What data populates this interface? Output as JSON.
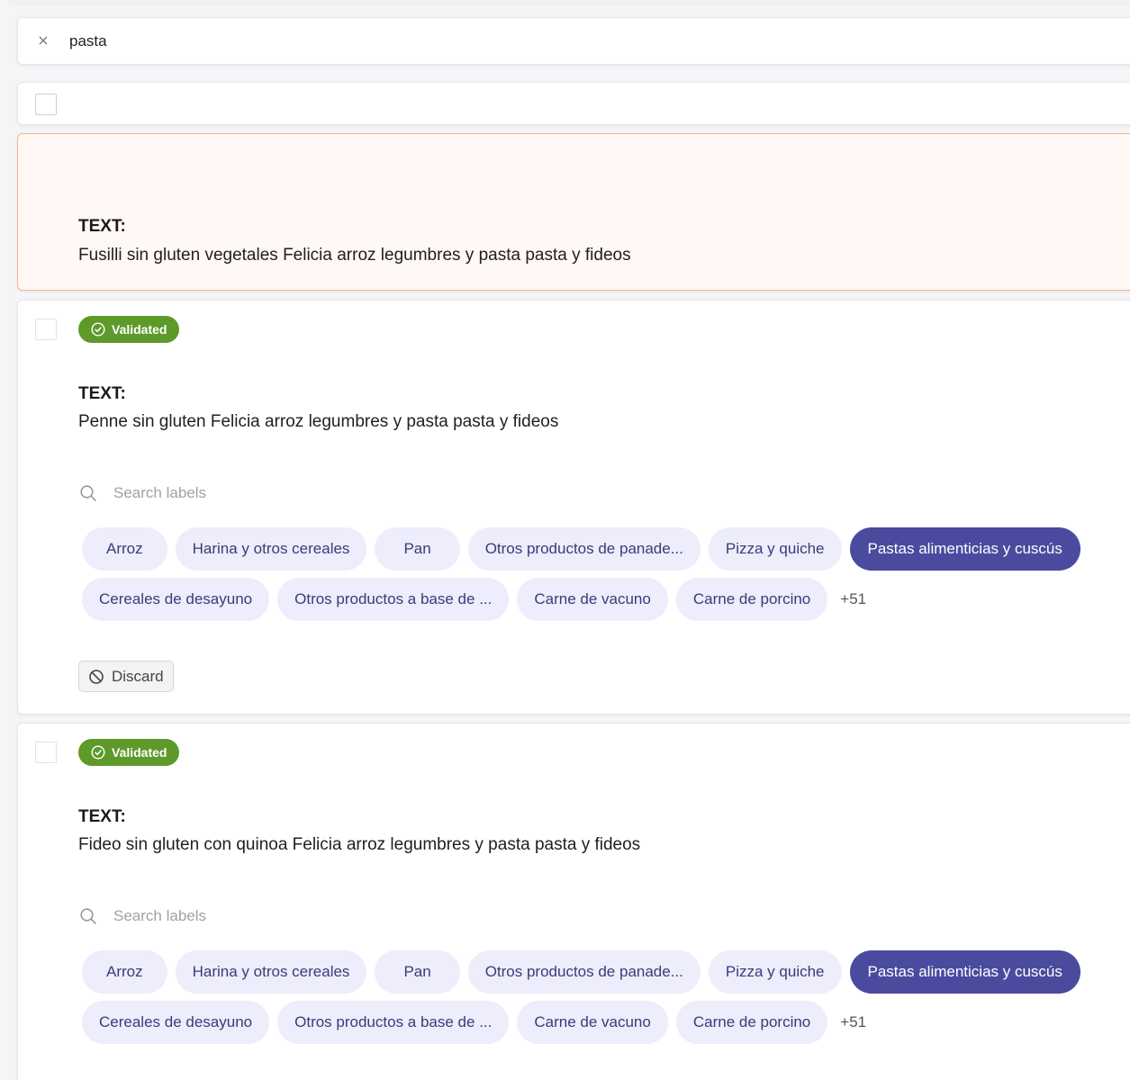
{
  "search": {
    "query": "pasta"
  },
  "text_label": "TEXT:",
  "records": [
    {
      "text": "Fusilli sin gluten vegetales Felicia arroz legumbres y pasta pasta y fideos"
    },
    {
      "status": "Validated",
      "text": "Penne sin gluten Felicia arroz legumbres y pasta pasta y fideos",
      "search_placeholder": "Search labels",
      "labels_row1": [
        "Arroz",
        "Harina y otros cereales",
        "Pan",
        "Otros productos de panade...",
        "Pizza y quiche",
        "Pastas alimenticias y cuscús"
      ],
      "labels_row2": [
        "Cereales de desayuno",
        "Otros productos a base de ...",
        "Carne de vacuno",
        "Carne de porcino"
      ],
      "more": "+51",
      "discard_label": "Discard"
    },
    {
      "status": "Validated",
      "text": "Fideo sin gluten con quinoa Felicia arroz legumbres y pasta pasta y fideos",
      "search_placeholder": "Search labels",
      "labels_row1": [
        "Arroz",
        "Harina y otros cereales",
        "Pan",
        "Otros productos de panade...",
        "Pizza y quiche",
        "Pastas alimenticias y cuscús"
      ],
      "labels_row2": [
        "Cereales de desayuno",
        "Otros productos a base de ...",
        "Carne de vacuno",
        "Carne de porcino"
      ],
      "more": "+51"
    }
  ],
  "icons": {
    "close": "close-icon",
    "validated": "check-circle-icon",
    "search": "search-icon",
    "discard": "ban-icon"
  },
  "colors": {
    "validated_badge": "#5d9a2a",
    "chip_bg": "#ededfb",
    "chip_text": "#3b3b7a",
    "chip_selected": "#4a4a9e",
    "active_border": "#f2b792",
    "active_bg": "#fff8f4"
  }
}
